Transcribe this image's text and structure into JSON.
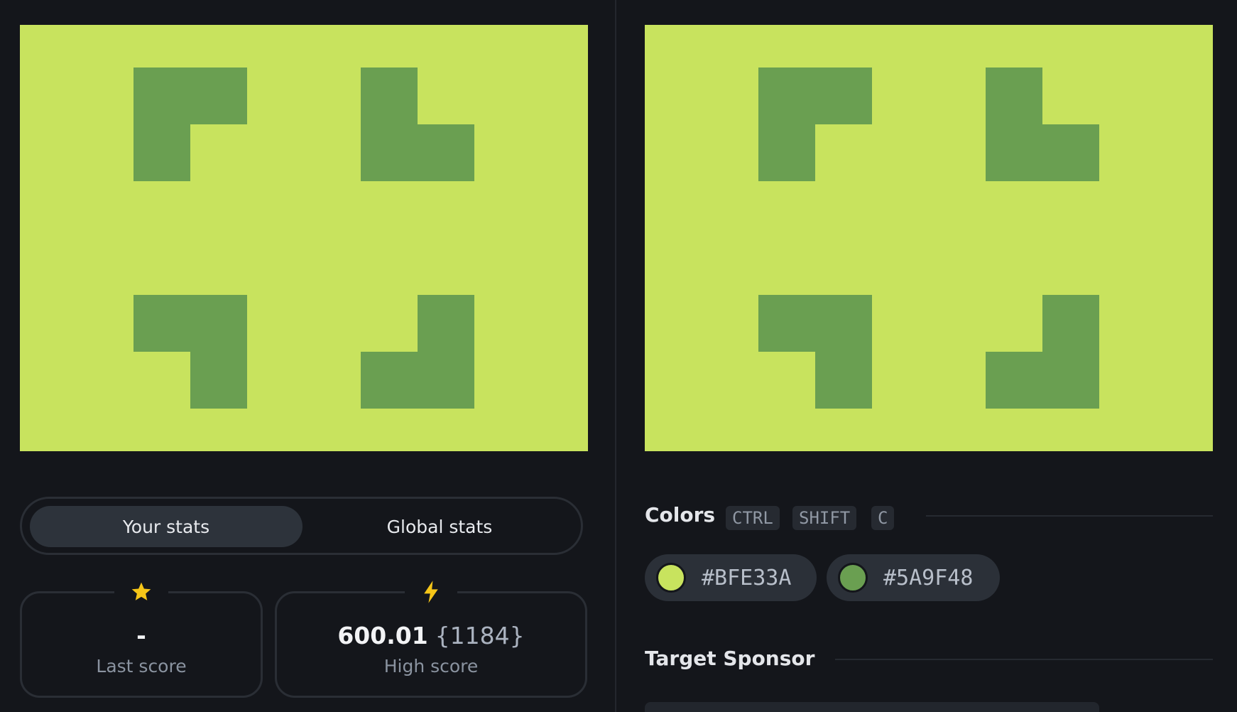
{
  "colors": {
    "background": "#BFE33A",
    "shape": "#5A9F48"
  },
  "stats": {
    "tabs": {
      "your": "Your stats",
      "global": "Global stats"
    },
    "last_score": {
      "value": "-",
      "label": "Last score",
      "icon": "star-icon"
    },
    "high_score": {
      "value": "600.01",
      "extra": "{1184}",
      "label": "High score",
      "icon": "lightning-icon"
    }
  },
  "colors_section": {
    "title": "Colors",
    "shortcut": [
      "CTRL",
      "SHIFT",
      "C"
    ],
    "swatches": [
      {
        "hex": "#BFE33A",
        "color": "#c8e35e"
      },
      {
        "hex": "#5A9F48",
        "color": "#6a9f51"
      }
    ]
  },
  "sponsor": {
    "title": "Target Sponsor"
  }
}
